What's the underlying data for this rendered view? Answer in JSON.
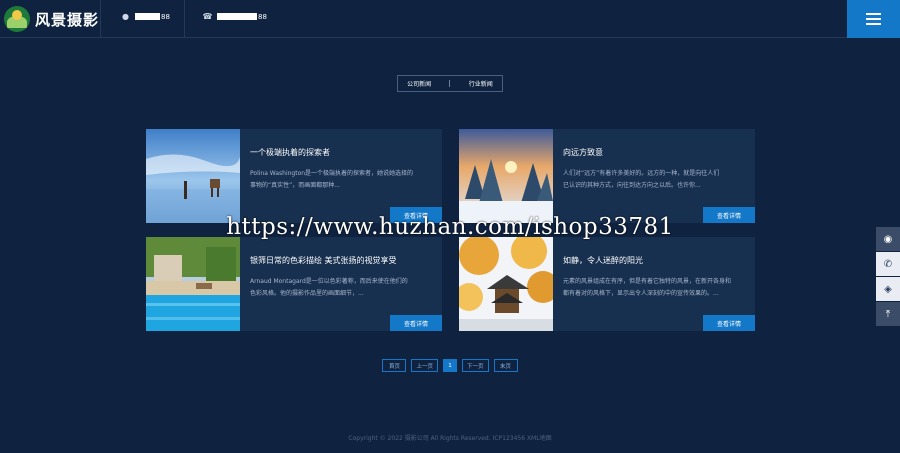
{
  "header": {
    "logo_text": "风景摄影",
    "phone1_tail": "88",
    "phone2_tail": "88"
  },
  "tabs": [
    "公司新闻",
    "行业新闻"
  ],
  "cards": [
    {
      "title": "一个极端执着的探索者",
      "desc1": "Polina Washington是一个极端执着的探索者，她说她选择的",
      "desc2": "事物的“真实性”，而画面都那种...",
      "button": "查看详情"
    },
    {
      "title": "向远方致意",
      "desc1": "人们对“远方”有着许多美好的。远方的一种，就是向往人们",
      "desc2": "已认识的其种方式，向往到达方向之以后。也许你...",
      "button": "查看详情"
    },
    {
      "title": "银筛日常的色彩描绘 美式张扬的视觉享受",
      "desc1": "Arnaud Montagard是一位以色彩著称，而后来使在他们的",
      "desc2": "色彩风格。他的摄影作品里的画面细节，...",
      "button": "查看详情"
    },
    {
      "title": "如静，令人迷醉的阳光",
      "desc1": "元素的风景组成在有序，但是有着它独特的风景，在新开各身和",
      "desc2": "都有着对的风格下，显示出令人深刻的中的宣传效果的。...",
      "button": "查看详情"
    }
  ],
  "pager": [
    "首页",
    "上一页",
    "1",
    "下一页",
    "末页"
  ],
  "footer": "Copyright © 2022 摄影公司 All Rights Reserved. ICP123456 XML地图",
  "watermark": "https://www.huzhan.com/ishop33781",
  "colors": {
    "background": "#0f2341",
    "card": "#17304f",
    "accent": "#1478c8"
  }
}
